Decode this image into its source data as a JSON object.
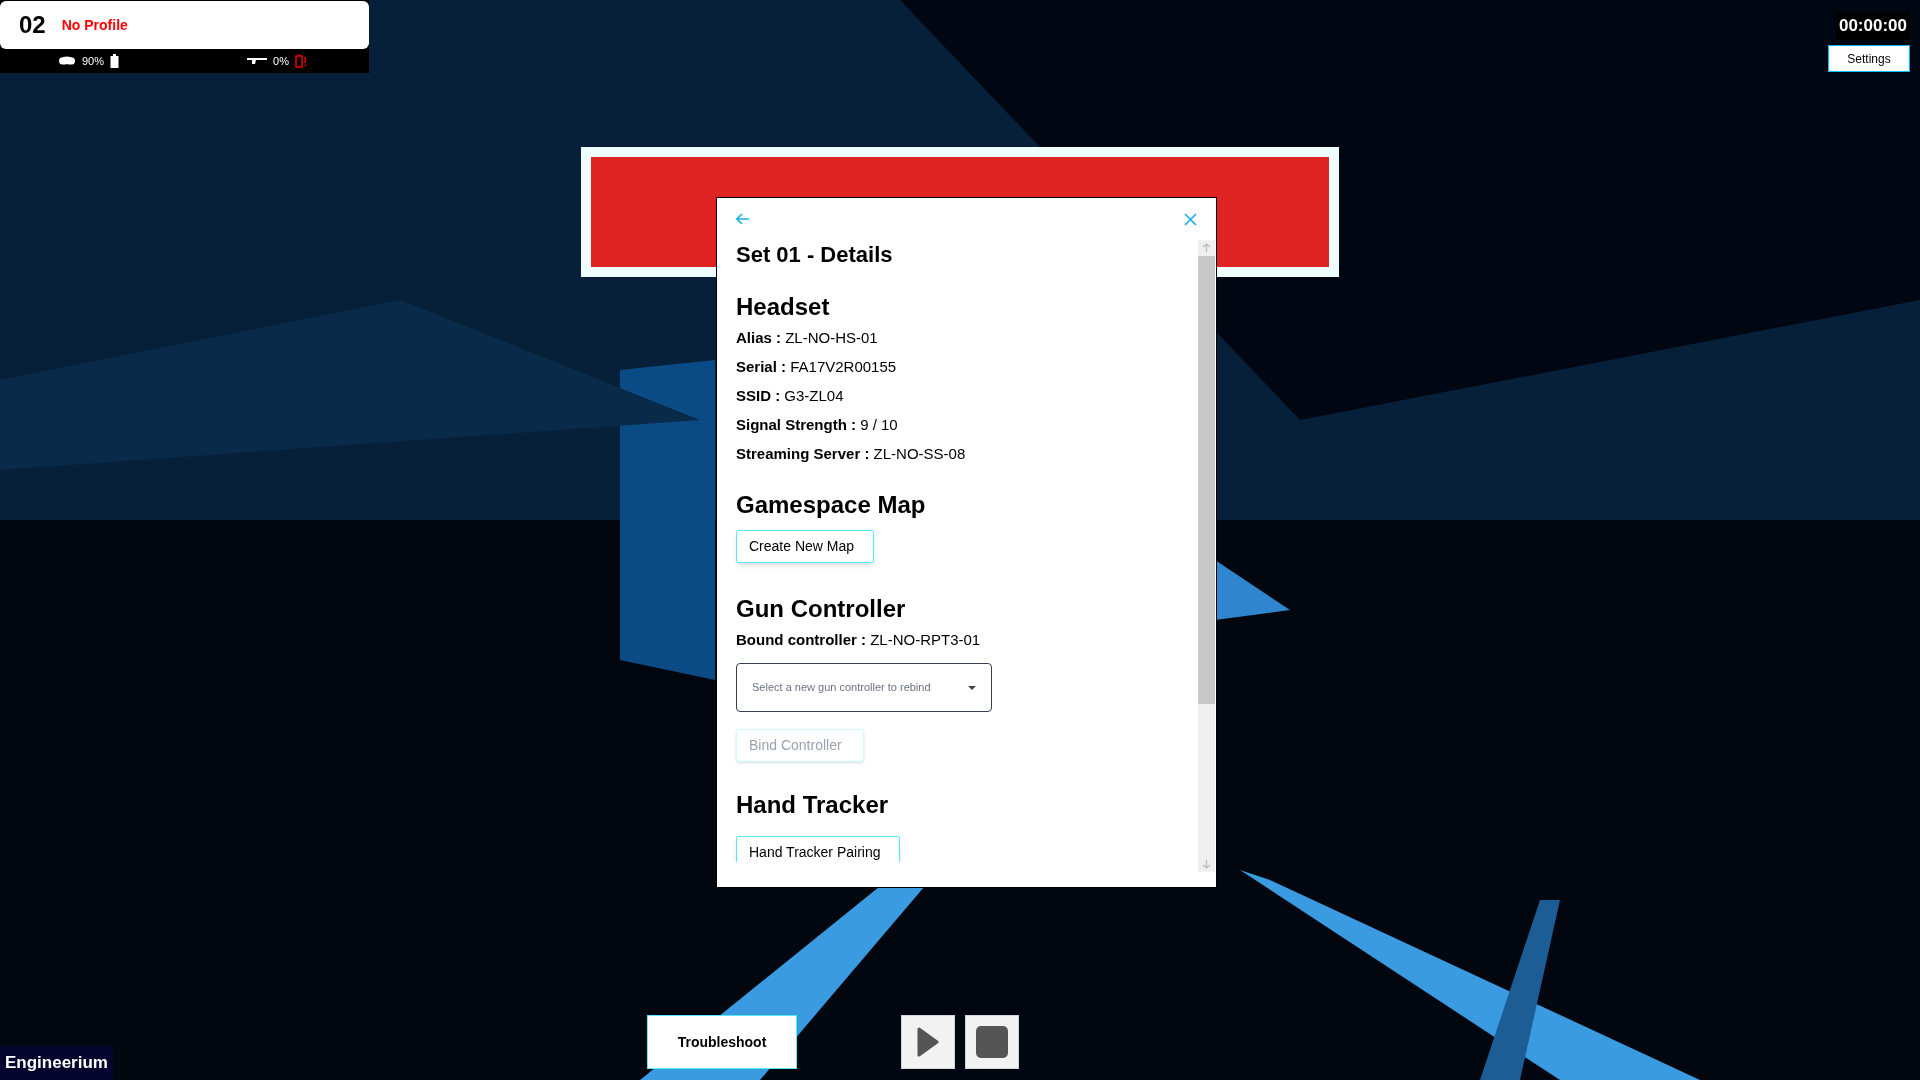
{
  "player": {
    "number": "02",
    "profile": "No Profile"
  },
  "batteries": [
    {
      "kind": "headset",
      "reading": "90%",
      "low": false
    },
    {
      "kind": "gun",
      "reading": "0%",
      "low": true
    }
  ],
  "timer": "00:00:00",
  "settings_button": "Settings",
  "dialog": {
    "title": "Set 01 - Details",
    "sections": [
      {
        "kind": "fields",
        "heading": "Headset",
        "fields": [
          {
            "label": "Alias :",
            "value": "ZL-NO-HS-01"
          },
          {
            "label": "Serial :",
            "value": "FA17V2R00155"
          },
          {
            "label": "SSID :",
            "value": "G3-ZL04"
          },
          {
            "label": "Signal Strength :",
            "value": "9 / 10"
          },
          {
            "label": "Streaming Server :",
            "value": "ZL-NO-SS-08"
          }
        ]
      },
      {
        "kind": "button",
        "heading": "Gamespace Map",
        "button": {
          "label": "Create New Map",
          "disabled": false
        }
      },
      {
        "kind": "controller",
        "heading": "Gun Controller",
        "fields": [
          {
            "label": "Bound controller :",
            "value": "ZL-NO-RPT3-01"
          }
        ],
        "select": {
          "placeholder": "Select a new gun controller to rebind"
        },
        "button": {
          "label": "Bind Controller",
          "disabled": true
        }
      },
      {
        "kind": "button",
        "heading": "Hand Tracker",
        "button": {
          "label": "Hand Tracker Pairing",
          "disabled": false
        }
      }
    ]
  },
  "troubleshoot_button": "Troubleshoot",
  "brand": "Engineerium"
}
